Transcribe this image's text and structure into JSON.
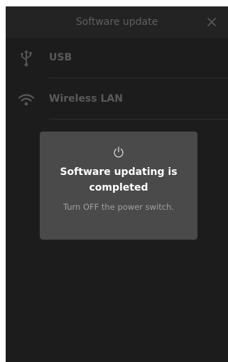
{
  "header": {
    "title": "Software update",
    "close_icon": "close-icon"
  },
  "list": {
    "items": [
      {
        "label": "USB",
        "icon": "usb-icon"
      },
      {
        "label": "Wireless LAN",
        "icon": "wifi-icon"
      }
    ]
  },
  "dialog": {
    "icon": "power-icon",
    "title": "Software updating is completed",
    "message": "Turn OFF the power switch."
  },
  "colors": {
    "screen_bg": "#1c1c1c",
    "header_bg": "#232323",
    "dialog_bg": "#4a4a4a",
    "dim_text": "#5a5a5a",
    "dialog_title": "#ffffff",
    "dialog_message": "#a0a0a0"
  }
}
